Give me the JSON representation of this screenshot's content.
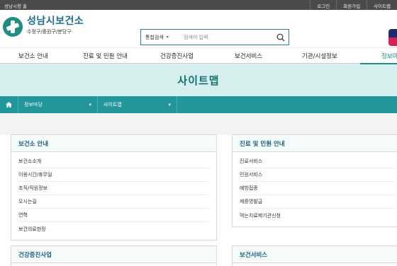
{
  "topbar": {
    "home_link": "성남시청 홈",
    "util_links": [
      "로그인",
      "회원가입",
      "사이트맵"
    ]
  },
  "logo": {
    "name": "성남시보건소",
    "sub": "수정구/중원구/분당구"
  },
  "search": {
    "scope": "통합검색",
    "placeholder": "검색어 입력"
  },
  "gnb": [
    "보건소 안내",
    "진료 및 민원 안내",
    "건강증진사업",
    "보건서비스",
    "기관/시설정보",
    "정보마당"
  ],
  "page_title": "사이트맵",
  "breadcrumb": [
    "정보마당",
    "사이트맵"
  ],
  "sections": [
    {
      "title": "보건소 안내",
      "items": [
        "보건소소개",
        "이용시간/휴무일",
        "조직/직원정보",
        "오시는길",
        "연혁",
        "보건의료현장"
      ]
    },
    {
      "title": "진료 및 민원 안내",
      "items": [
        "진료서비스",
        "민원서비스",
        "예방접종",
        "제증명발급",
        "먹는치료제기관신청"
      ]
    },
    {
      "title": "건강증진사업",
      "items": []
    },
    {
      "title": "보건서비스",
      "items": []
    }
  ],
  "colors": {
    "accent": "#21979b",
    "title": "#15716d",
    "band": "#d7eeee",
    "topbar": "#4a4a4a"
  }
}
